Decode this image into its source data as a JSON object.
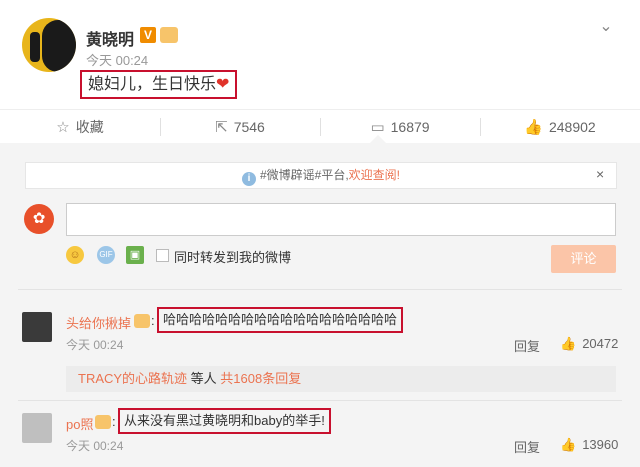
{
  "post": {
    "author": "黄晓明",
    "verified_badge": "V",
    "time": "今天 00:24",
    "content": "媳妇儿，生日快乐",
    "heart": "❤",
    "more_icon": "chevron-down-icon"
  },
  "actions": [
    {
      "icon": "star-icon",
      "glyph": "☆",
      "label": "收藏"
    },
    {
      "icon": "share-icon",
      "glyph": "⇱",
      "label": "7546"
    },
    {
      "icon": "comment-icon",
      "glyph": "▭",
      "label": "16879"
    },
    {
      "icon": "thumbs-up-icon",
      "glyph": "👍",
      "label": "248902"
    }
  ],
  "comment_panel": {
    "notice_prefix": "#微博辟谣#平台,",
    "notice_link": "欢迎查阅!",
    "notice_close": "×",
    "forward_label": "同时转发到我的微博",
    "submit_label": "评论"
  },
  "comments": [
    {
      "user": "头给你揪掉",
      "text": "哈哈哈哈哈哈哈哈哈哈哈哈哈哈哈哈哈哈",
      "time": "今天 00:24",
      "reply_label": "回复",
      "likes": "20472",
      "sub_reply_user": "TRACY的心路轨迹",
      "sub_reply_text": " 等人 ",
      "sub_reply_count": "共1608条回复"
    },
    {
      "user": "po照",
      "text": "从来没有黑过黄晓明和baby的举手!",
      "time": "今天 00:24",
      "reply_label": "回复",
      "likes": "13960"
    }
  ],
  "colors": {
    "highlight_border": "#c8102e",
    "username": "#eb7350",
    "submit_disabled": "#fbc5a8"
  }
}
